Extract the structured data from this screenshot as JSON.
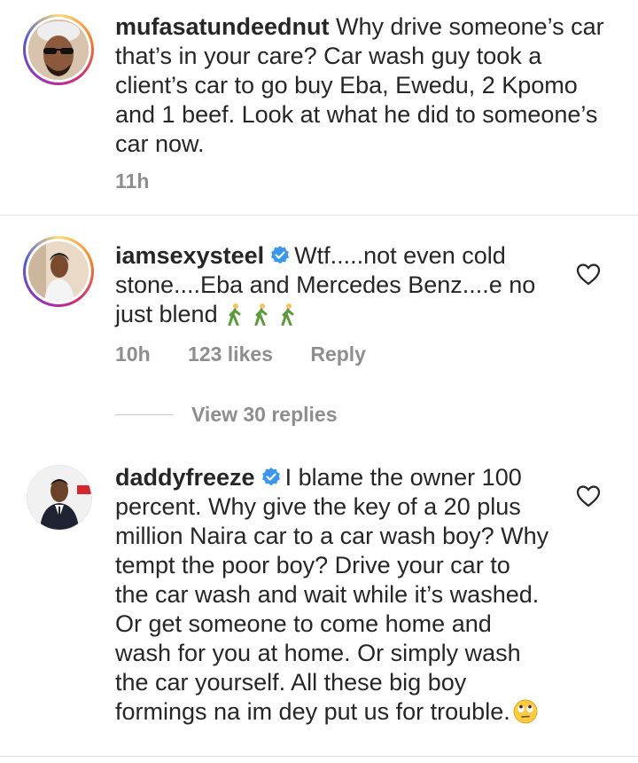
{
  "comments": [
    {
      "username": "mufasatundeednut",
      "verified": false,
      "text": "Why drive someone’s car that’s in your care? Car wash guy took a client’s car to go buy Eba, Ewedu, 2 Kpomo and 1 beef. Look at what he did to someone’s car now.",
      "time": "11h",
      "likes": "",
      "reply_label": ""
    },
    {
      "username": "iamsexysteel",
      "verified": true,
      "text": "Wtf.....not even cold stone....Eba and Mercedes Benz....e no just blend",
      "emoji": "person-walking-emoji x3",
      "time": "10h",
      "likes": "123 likes",
      "reply_label": "Reply",
      "view_replies": "View 30 replies"
    },
    {
      "username": "daddyfreeze",
      "verified": true,
      "text": "I blame the owner 100 percent. Why give the key of a 20 plus million Naira car to a car wash boy? Why tempt the poor boy? Drive your car to the car wash and wait while it’s washed. Or get someone to come home and wash for you at home. Or simply wash the car yourself. All these big boy formings na im dey put us for trouble.",
      "emoji": "face-with-rolling-eyes-emoji"
    }
  ],
  "colors": {
    "text": "#262626",
    "muted": "#8e8e8e",
    "verified": "#3897f0"
  }
}
